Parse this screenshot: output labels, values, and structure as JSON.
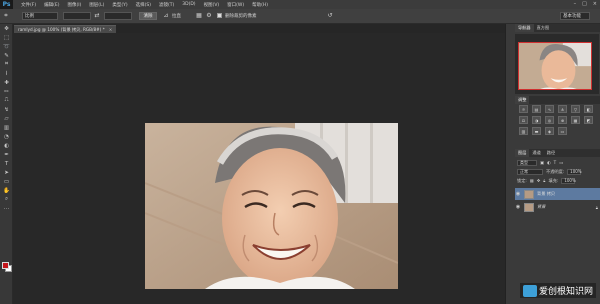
{
  "menubar": {
    "logo": "Ps",
    "items": [
      "文件(F)",
      "编辑(E)",
      "图像(I)",
      "图层(L)",
      "类型(Y)",
      "选择(S)",
      "滤镜(T)",
      "3D(D)",
      "视图(V)",
      "窗口(W)",
      "帮助(H)"
    ]
  },
  "options": {
    "ratio_value": "比例",
    "clear_button": "清除",
    "straighten_label": "拉直",
    "view_label": "视图:",
    "delete_pixels_label": "删除裁剪的像素",
    "workspace": "基本功能"
  },
  "document": {
    "tab_title": "ramlyd.jpg @ 100% (背景 拷贝, RGB/8#) *",
    "close": "×"
  },
  "panels": {
    "navigator_tabs": [
      "导航器",
      "直方图"
    ],
    "adjust_tab": "调整",
    "layers_tabs": [
      "图层",
      "通道",
      "路径"
    ],
    "kind_label": "类型",
    "blend_mode": "正常",
    "opacity_label": "不透明度:",
    "opacity_value": "100%",
    "lock_label": "锁定:",
    "fill_label": "填充:",
    "fill_value": "100%",
    "layers": [
      {
        "name": "背景 拷贝",
        "selected": true
      },
      {
        "name": "背景",
        "selected": false
      }
    ]
  },
  "watermark": "爱创根知识网",
  "colors": {
    "foreground": "#c4161c",
    "background": "#ffffff",
    "accent": "#5d7aa0"
  }
}
